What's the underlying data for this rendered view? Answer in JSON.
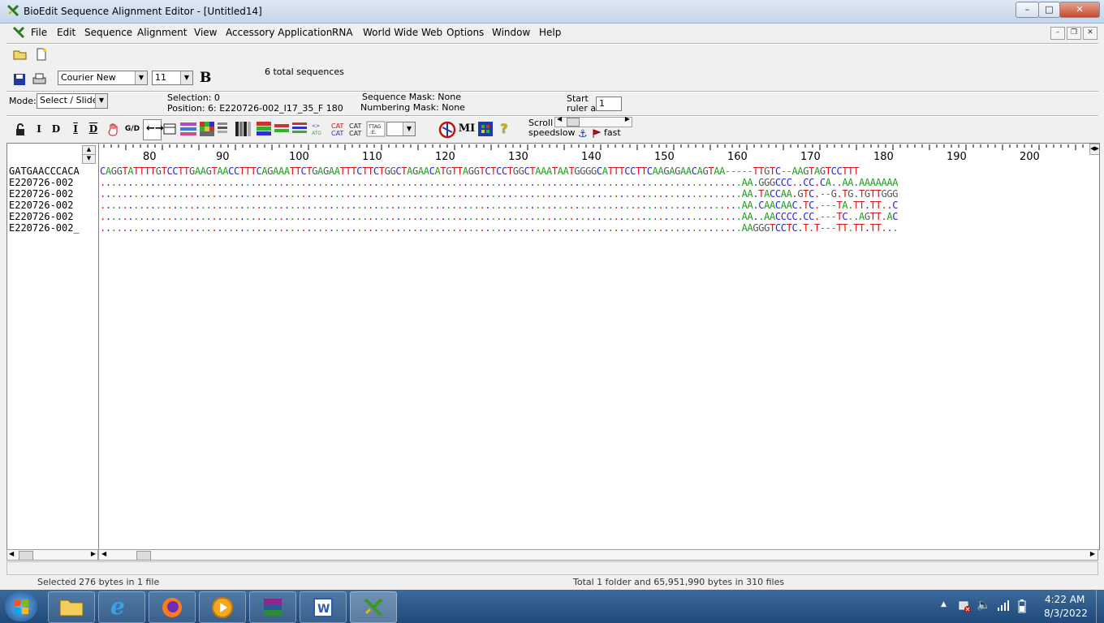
{
  "window": {
    "title": "BioEdit Sequence Alignment Editor - [Untitled14]"
  },
  "menu": [
    "File",
    "Edit",
    "Sequence",
    "Alignment",
    "View",
    "Accessory Application",
    "RNA",
    "World Wide Web",
    "Options",
    "Window",
    "Help"
  ],
  "toolbar": {
    "font_name": "Courier New",
    "font_size": "11",
    "bold_label": "B",
    "total_sequences": "6 total sequences"
  },
  "infobar": {
    "mode_label": "Mode:",
    "mode_value": "Select / Slide",
    "selection_label": "Selection: 0",
    "position_label": "Position:  6: E220726-002_I17_35_F 180",
    "sequence_mask": "Sequence Mask: None",
    "numbering_mask": "Numbering Mask: None",
    "start_label": "Start",
    "ruler_label": "ruler at:",
    "ruler_value": "1"
  },
  "toolbar2": {
    "icons": [
      "I",
      "D",
      "I",
      "D",
      "G/D"
    ],
    "mi_label": "MI",
    "scroll_label": "Scroll",
    "speed_label": "speed",
    "slow_label": "slow",
    "fast_label": "fast"
  },
  "ruler": [
    "80",
    "90",
    "100",
    "110",
    "120",
    "130",
    "140",
    "150",
    "160",
    "170",
    "180",
    "190",
    "200"
  ],
  "names": [
    "GATGAACCCACA",
    "E220726-002",
    "E220726-002",
    "E220726-002",
    "E220726-002",
    "E220726-002_"
  ],
  "sequences": [
    "CAGGTATTTTGTCCTTGAAGTAACCTTTCAGAAATTCTGAGAATTTCTTCTGGCTAGAACATGTTAGGTCTCCTGGCTAAATAATGGGGCATTTCCTTCAAGAGAACAGTAA-----TTGTC--AAGTAGTCCTTT",
    "...................................................................................................................AA.GGGCCC..CC.CA..AA.AAAAAAA",
    "...................................................................................................................AA.TACCAA.GTC.--G.TG.TGTTGGG",
    "...................................................................................................................AA.CAACAAC.TC.---TA.TT.TT..C",
    "...................................................................................................................AA..AACCCC.CC.---TC..AGTT.AC",
    "...................................................................................................................AAGGGTCCTC.T.T---TT.TT.TT..."
  ],
  "status": {
    "left": "Selected 276 bytes in 1 file",
    "right": "Total 1 folder and 65,951,990 bytes in 310 files"
  },
  "taskbar": {
    "time": "4:22 AM",
    "date": "8/3/2022",
    "apps": [
      "windows-explorer",
      "internet-explorer",
      "firefox",
      "media-player",
      "winrar",
      "word",
      "bioedit"
    ]
  },
  "colors": {
    "A": "#1b9e1b",
    "C": "#2424d8",
    "G": "#555555",
    "T": "#d71515"
  }
}
